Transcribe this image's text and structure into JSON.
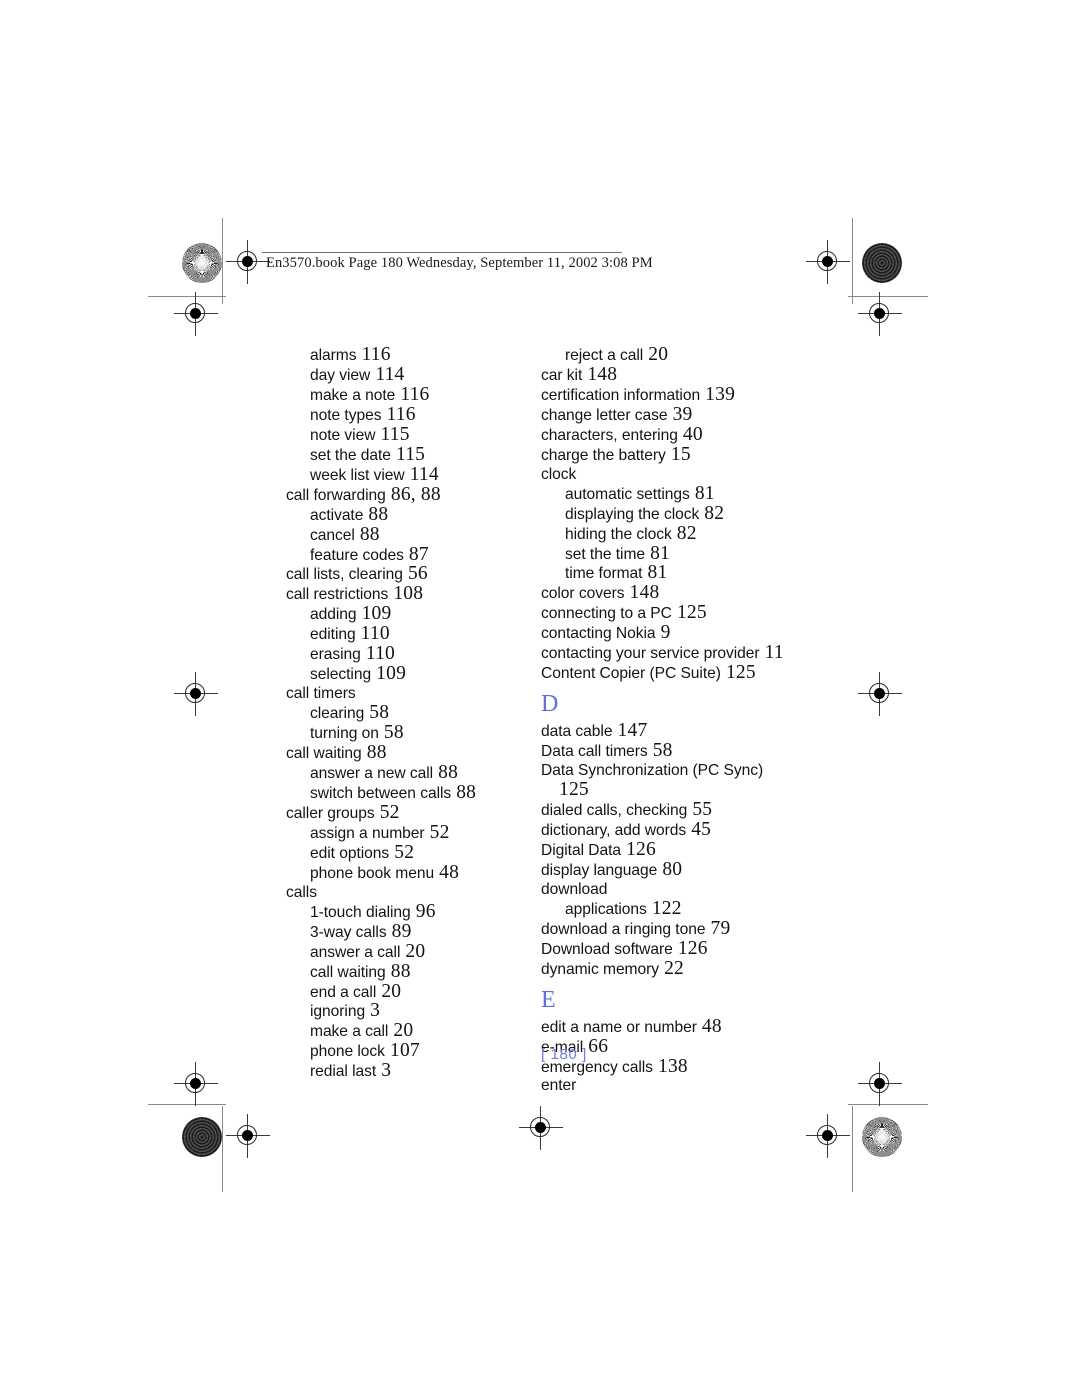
{
  "header": {
    "text": "En3570.book  Page 180  Wednesday, September 11, 2002  3:08 PM"
  },
  "folio": {
    "text": "[ 180 ]"
  },
  "index": {
    "left_column": [
      {
        "level": 2,
        "label": "alarms",
        "page": "116"
      },
      {
        "level": 2,
        "label": "day view",
        "page": "114"
      },
      {
        "level": 2,
        "label": "make a note",
        "page": "116"
      },
      {
        "level": 2,
        "label": "note types",
        "page": "116"
      },
      {
        "level": 2,
        "label": "note view",
        "page": "115"
      },
      {
        "level": 2,
        "label": "set the date",
        "page": "115"
      },
      {
        "level": 2,
        "label": "week list view",
        "page": "114"
      },
      {
        "level": 1,
        "label": "call forwarding",
        "page": "86, 88"
      },
      {
        "level": 2,
        "label": "activate",
        "page": "88"
      },
      {
        "level": 2,
        "label": "cancel",
        "page": "88"
      },
      {
        "level": 2,
        "label": "feature codes",
        "page": "87"
      },
      {
        "level": 1,
        "label": "call lists, clearing",
        "page": "56"
      },
      {
        "level": 1,
        "label": "call restrictions",
        "page": "108"
      },
      {
        "level": 2,
        "label": "adding",
        "page": "109"
      },
      {
        "level": 2,
        "label": "editing",
        "page": "110"
      },
      {
        "level": 2,
        "label": "erasing",
        "page": "110"
      },
      {
        "level": 2,
        "label": "selecting",
        "page": "109"
      },
      {
        "level": 1,
        "label": "call timers",
        "page": ""
      },
      {
        "level": 2,
        "label": "clearing",
        "page": "58"
      },
      {
        "level": 2,
        "label": "turning on",
        "page": "58"
      },
      {
        "level": 1,
        "label": "call waiting",
        "page": "88"
      },
      {
        "level": 2,
        "label": "answer a new call",
        "page": "88"
      },
      {
        "level": 2,
        "label": "switch between calls",
        "page": "88"
      },
      {
        "level": 1,
        "label": "caller groups",
        "page": "52"
      },
      {
        "level": 2,
        "label": "assign a number",
        "page": "52"
      },
      {
        "level": 2,
        "label": "edit options",
        "page": "52"
      },
      {
        "level": 2,
        "label": "phone book menu",
        "page": "48"
      },
      {
        "level": 1,
        "label": "calls",
        "page": ""
      },
      {
        "level": 2,
        "label": "1-touch dialing",
        "page": "96"
      },
      {
        "level": 2,
        "label": "3-way calls",
        "page": "89"
      },
      {
        "level": 2,
        "label": "answer a call",
        "page": "20"
      },
      {
        "level": 2,
        "label": "call waiting",
        "page": "88"
      },
      {
        "level": 2,
        "label": "end a call",
        "page": "20"
      },
      {
        "level": 2,
        "label": "ignoring",
        "page": "3"
      },
      {
        "level": 2,
        "label": "make a call",
        "page": "20"
      },
      {
        "level": 2,
        "label": "phone lock",
        "page": "107"
      },
      {
        "level": 2,
        "label": "redial last",
        "page": "3"
      }
    ],
    "right_column": [
      {
        "level": 2,
        "label": "reject a call",
        "page": "20"
      },
      {
        "level": 1,
        "label": "car kit",
        "page": "148"
      },
      {
        "level": 1,
        "label": "certification information",
        "page": "139"
      },
      {
        "level": 1,
        "label": "change letter case",
        "page": "39"
      },
      {
        "level": 1,
        "label": "characters, entering",
        "page": "40"
      },
      {
        "level": 1,
        "label": "charge the battery",
        "page": "15"
      },
      {
        "level": 1,
        "label": "clock",
        "page": ""
      },
      {
        "level": 2,
        "label": "automatic settings",
        "page": "81"
      },
      {
        "level": 2,
        "label": "displaying the clock",
        "page": "82"
      },
      {
        "level": 2,
        "label": "hiding the clock",
        "page": "82"
      },
      {
        "level": 2,
        "label": "set the time",
        "page": "81"
      },
      {
        "level": 2,
        "label": "time format",
        "page": "81"
      },
      {
        "level": 1,
        "label": "color covers",
        "page": "148"
      },
      {
        "level": 1,
        "label": "connecting to a PC",
        "page": "125"
      },
      {
        "level": 1,
        "label": "contacting Nokia",
        "page": "9"
      },
      {
        "level": 1,
        "label": "contacting your service provider",
        "page": "11"
      },
      {
        "level": 1,
        "label": "Content Copier (PC Suite)",
        "page": "125"
      },
      {
        "section": "D"
      },
      {
        "level": 1,
        "label": "data cable",
        "page": "147"
      },
      {
        "level": 1,
        "label": "Data call timers",
        "page": "58"
      },
      {
        "level": 1,
        "label": "Data Synchronization (PC Sync)",
        "page": "",
        "wrapped_page": "125"
      },
      {
        "level": 1,
        "label": "dialed calls, checking",
        "page": "55"
      },
      {
        "level": 1,
        "label": "dictionary, add words",
        "page": "45"
      },
      {
        "level": 1,
        "label": "Digital Data",
        "page": "126"
      },
      {
        "level": 1,
        "label": "display language",
        "page": "80"
      },
      {
        "level": 1,
        "label": "download",
        "page": ""
      },
      {
        "level": 2,
        "label": "applications",
        "page": "122"
      },
      {
        "level": 1,
        "label": "download a ringing tone",
        "page": "79"
      },
      {
        "level": 1,
        "label": "Download software",
        "page": "126"
      },
      {
        "level": 1,
        "label": "dynamic memory",
        "page": "22"
      },
      {
        "section": "E"
      },
      {
        "level": 1,
        "label": "edit a name or number",
        "page": "48"
      },
      {
        "level": 1,
        "label": "e-mail",
        "page": "66"
      },
      {
        "level": 1,
        "label": "emergency calls",
        "page": "138"
      },
      {
        "level": 1,
        "label": "enter",
        "page": ""
      }
    ]
  },
  "colors": {
    "section_letter": "#5d71d6",
    "folio": "#6b7fe0",
    "body_text": "#141414",
    "crop_rule": "#8a8a8a"
  }
}
